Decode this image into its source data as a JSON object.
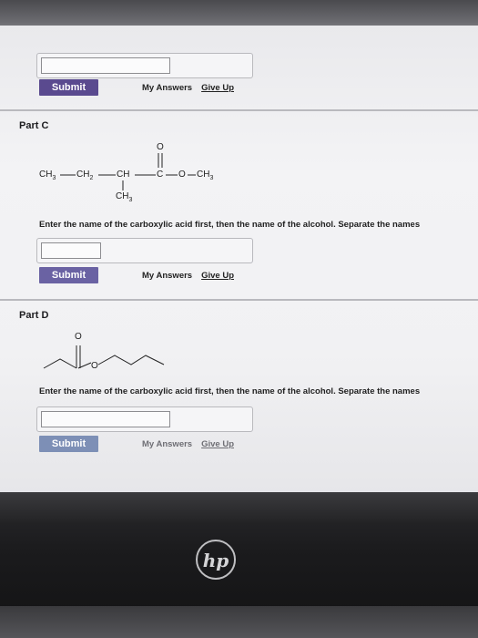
{
  "partB": {
    "submit_label": "Submit",
    "my_answers": "My Answers",
    "give_up": "Give Up"
  },
  "partC": {
    "label": "Part C",
    "formula": {
      "ch3_left": "CH3",
      "ch2": "CH2",
      "ch": "CH",
      "c": "C",
      "o_top": "O",
      "o_mid": "O",
      "ch3_right": "CH3",
      "ch3_branch": "CH3"
    },
    "instruction": "Enter the name of the carboxylic acid first, then the name of the alcohol. Separate the names",
    "submit_label": "Submit",
    "my_answers": "My Answers",
    "give_up": "Give Up"
  },
  "partD": {
    "label": "Part D",
    "atom_o_top": "O",
    "atom_o_ring": "O",
    "instruction": "Enter the name of the carboxylic acid first, then the name of the alcohol. Separate the names",
    "submit_label": "Submit",
    "my_answers": "My Answers",
    "give_up": "Give Up"
  },
  "laptop": {
    "logo_text": "hp"
  }
}
